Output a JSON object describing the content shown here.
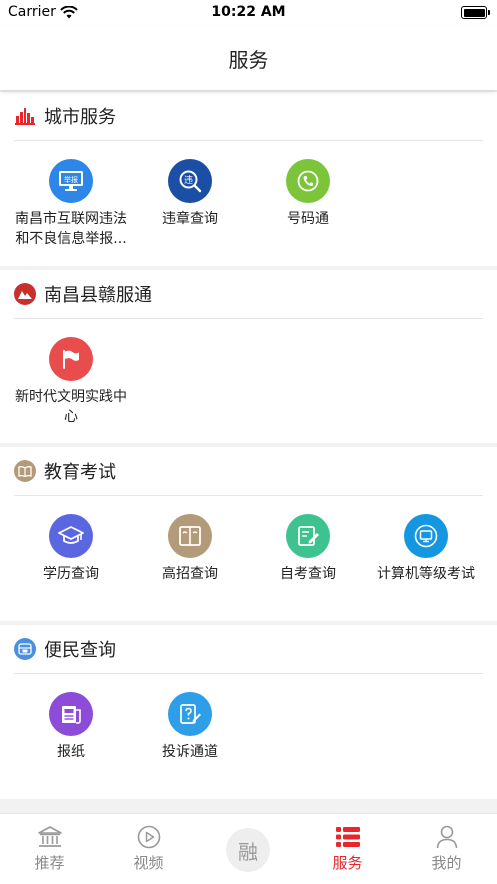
{
  "status_bar": {
    "carrier": "Carrier",
    "time": "10:22 AM"
  },
  "nav": {
    "title": "服务"
  },
  "sections": [
    {
      "title": "城市服务",
      "icon": "city-skyline-icon",
      "items": [
        {
          "label": "南昌市互联网违法和不良信息举报...",
          "icon": "report-monitor-icon",
          "color": "#2e86e6"
        },
        {
          "label": "违章查询",
          "icon": "traffic-violation-search-icon",
          "color": "#1b4fa6"
        },
        {
          "label": "号码通",
          "icon": "phone-icon",
          "color": "#7cc43a"
        }
      ]
    },
    {
      "title": "南昌县赣服通",
      "icon": "ganfutong-logo-icon",
      "items": [
        {
          "label": "新时代文明实践中心",
          "icon": "flag-icon",
          "color": "#e84c4c"
        }
      ]
    },
    {
      "title": "教育考试",
      "icon": "book-icon",
      "items": [
        {
          "label": "学历查询",
          "icon": "graduation-cap-icon",
          "color": "#5b67e0"
        },
        {
          "label": "高招查询",
          "icon": "open-book-icon",
          "color": "#b39a78"
        },
        {
          "label": "自考查询",
          "icon": "edit-document-icon",
          "color": "#3ec28f"
        },
        {
          "label": "计算机等级考试",
          "icon": "computer-icon",
          "color": "#1596e0"
        }
      ]
    },
    {
      "title": "便民查询",
      "icon": "convenience-icon",
      "items": [
        {
          "label": "报纸",
          "icon": "newspaper-icon",
          "color": "#8c4bd8"
        },
        {
          "label": "投诉通道",
          "icon": "complaint-icon",
          "color": "#2e9ee8"
        }
      ]
    }
  ],
  "tabbar": {
    "items": [
      {
        "label": "推荐",
        "icon": "landmark-icon"
      },
      {
        "label": "视频",
        "icon": "play-circle-icon"
      },
      {
        "label": "融",
        "icon": "rong-icon"
      },
      {
        "label": "服务",
        "icon": "list-icon",
        "active": true
      },
      {
        "label": "我的",
        "icon": "user-icon"
      }
    ]
  },
  "colors": {
    "accent": "#e8262c",
    "background": "#f2f2f2"
  }
}
